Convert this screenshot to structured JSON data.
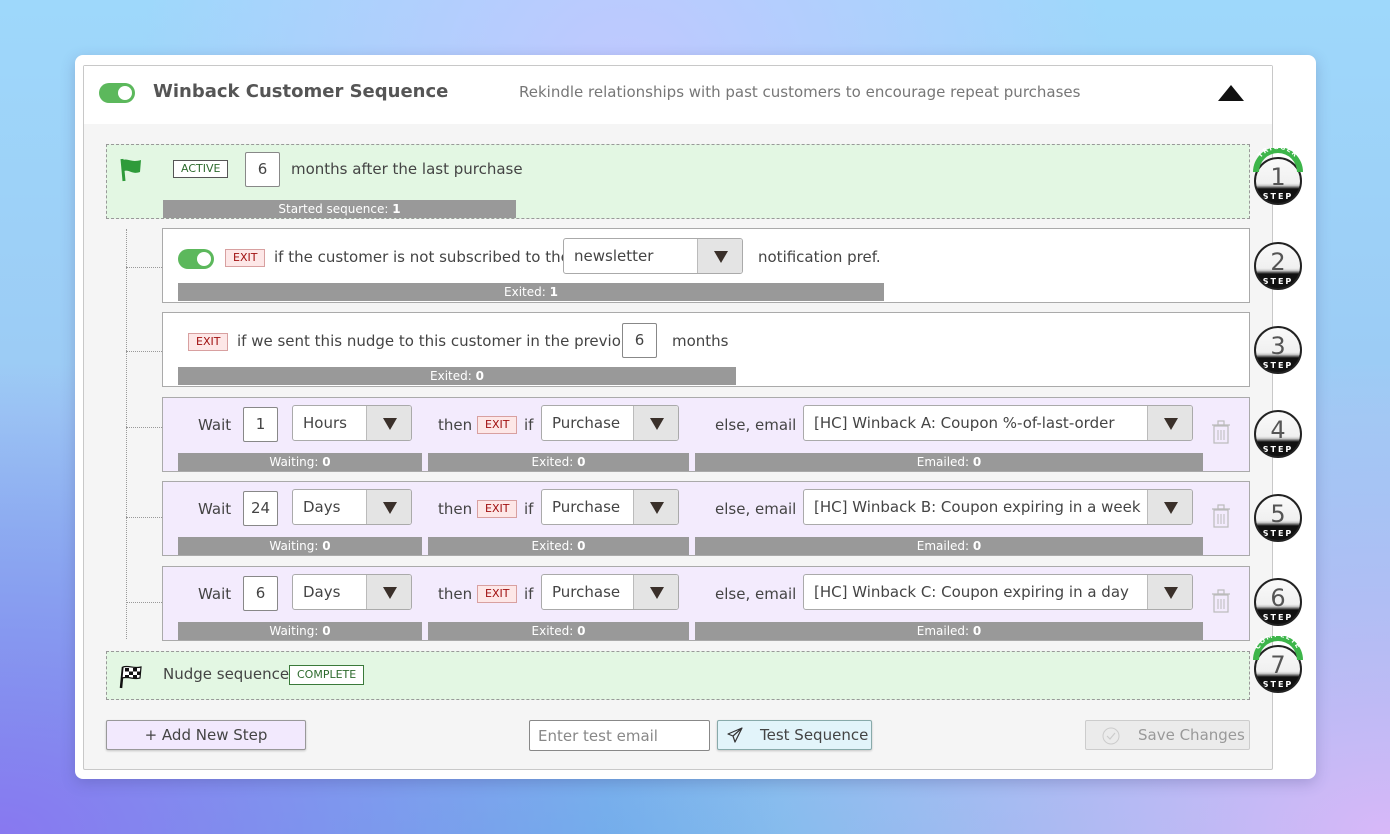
{
  "sequence": {
    "enabled": true,
    "title": "Winback Customer Sequence",
    "description": "Rekindle relationships with past customers to encourage repeat purchases"
  },
  "steps": [
    {
      "number": "1",
      "arc_label": "TRIGGER",
      "medal_label": "STEP",
      "badge": "ACTIVE",
      "value": "6",
      "text": "months after the last purchase",
      "stat_label": "Started sequence: ",
      "stat_value": "1"
    },
    {
      "number": "2",
      "medal_label": "STEP",
      "enabled": true,
      "badge": "EXIT",
      "text_before": "if the customer is not subscribed to the",
      "select": "newsletter",
      "text_after": "notification pref.",
      "stat_label": "Exited: ",
      "stat_value": "1"
    },
    {
      "number": "3",
      "medal_label": "STEP",
      "badge": "EXIT",
      "text_before": "if we sent this nudge to this customer in the previous",
      "value": "6",
      "text_after": "months",
      "stat_label": "Exited: ",
      "stat_value": "0"
    },
    {
      "number": "4",
      "medal_label": "STEP",
      "wait_label": "Wait",
      "wait_value": "1",
      "unit": "Hours",
      "then_label": "then",
      "badge": "EXIT",
      "if_label": "if",
      "condition": "Purchase",
      "else_label": "else, email",
      "email": "[HC] Winback A: Coupon %-of-last-order",
      "waiting_label": "Waiting: ",
      "waiting_value": "0",
      "exited_label": "Exited: ",
      "exited_value": "0",
      "emailed_label": "Emailed: ",
      "emailed_value": "0"
    },
    {
      "number": "5",
      "medal_label": "STEP",
      "wait_label": "Wait",
      "wait_value": "24",
      "unit": "Days",
      "then_label": "then",
      "badge": "EXIT",
      "if_label": "if",
      "condition": "Purchase",
      "else_label": "else, email",
      "email": "[HC] Winback B: Coupon expiring in a week",
      "waiting_label": "Waiting: ",
      "waiting_value": "0",
      "exited_label": "Exited: ",
      "exited_value": "0",
      "emailed_label": "Emailed: ",
      "emailed_value": "0"
    },
    {
      "number": "6",
      "medal_label": "STEP",
      "wait_label": "Wait",
      "wait_value": "6",
      "unit": "Days",
      "then_label": "then",
      "badge": "EXIT",
      "if_label": "if",
      "condition": "Purchase",
      "else_label": "else, email",
      "email": "[HC] Winback C: Coupon expiring in a day",
      "waiting_label": "Waiting: ",
      "waiting_value": "0",
      "exited_label": "Exited: ",
      "exited_value": "0",
      "emailed_label": "Emailed: ",
      "emailed_value": "0"
    },
    {
      "number": "7",
      "arc_label": "COMPLETE",
      "medal_label": "STEP",
      "text": "Nudge sequence",
      "badge": "COMPLETE"
    }
  ],
  "footer": {
    "add_step": "+ Add New Step",
    "test_email_placeholder": "Enter test email",
    "test_email_value": "",
    "test_button": "Test Sequence",
    "save_button": "Save Changes"
  },
  "colors": {
    "toggle_on": "#5cb85c",
    "trigger_bg": "#e3f7e3",
    "wait_bg": "#f3ebfd",
    "exit_badge": "#a01010",
    "arc_green": "#3db54a",
    "stat_bar": "#999999"
  }
}
